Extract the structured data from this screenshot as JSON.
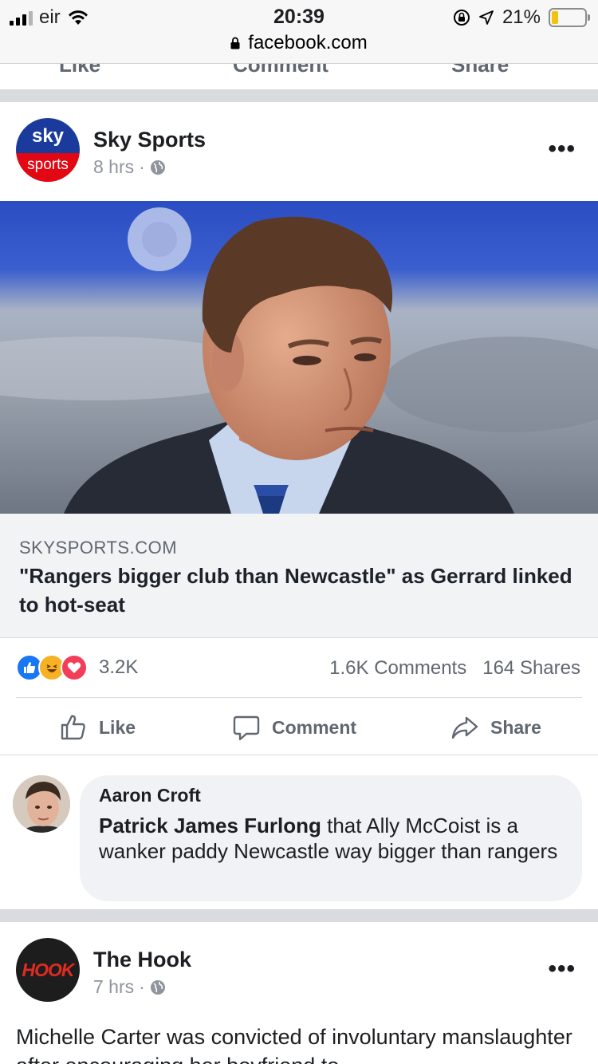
{
  "status_bar": {
    "carrier": "eir",
    "time": "20:39",
    "battery": "21%",
    "battery_level": 0.21,
    "url": "facebook.com"
  },
  "prev_actions": {
    "like": "Like",
    "comment": "Comment",
    "share": "Share"
  },
  "post": {
    "page_name": "Sky Sports",
    "avatar_top": "sky",
    "avatar_bottom": "sports",
    "time": "8 hrs",
    "separator": "·",
    "more": "•••",
    "link_domain": "SKYSPORTS.COM",
    "link_title": "\"Rangers bigger club than Newcastle\" as Gerrard linked to hot-seat",
    "reaction_count": "3.2K",
    "comments": "1.6K Comments",
    "shares": "164 Shares",
    "actions": {
      "like": "Like",
      "comment": "Comment",
      "share": "Share"
    }
  },
  "comment": {
    "author": "Aaron Croft",
    "tag": "Patrick James Furlong",
    "text": " that Ally McCoist is a wanker paddy Newcastle way bigger than rangers"
  },
  "next_post": {
    "page_name": "The Hook",
    "avatar_text": "HOOK",
    "time": "7 hrs",
    "separator": "·",
    "more": "•••",
    "text": "Michelle Carter was convicted of involuntary manslaughter after encouraging her boyfriend to"
  },
  "colors": {
    "facebook_blue": "#1877f2",
    "sky_blue": "#1a3a9c",
    "sky_red": "#e30613",
    "hook_red": "#e02b20"
  }
}
